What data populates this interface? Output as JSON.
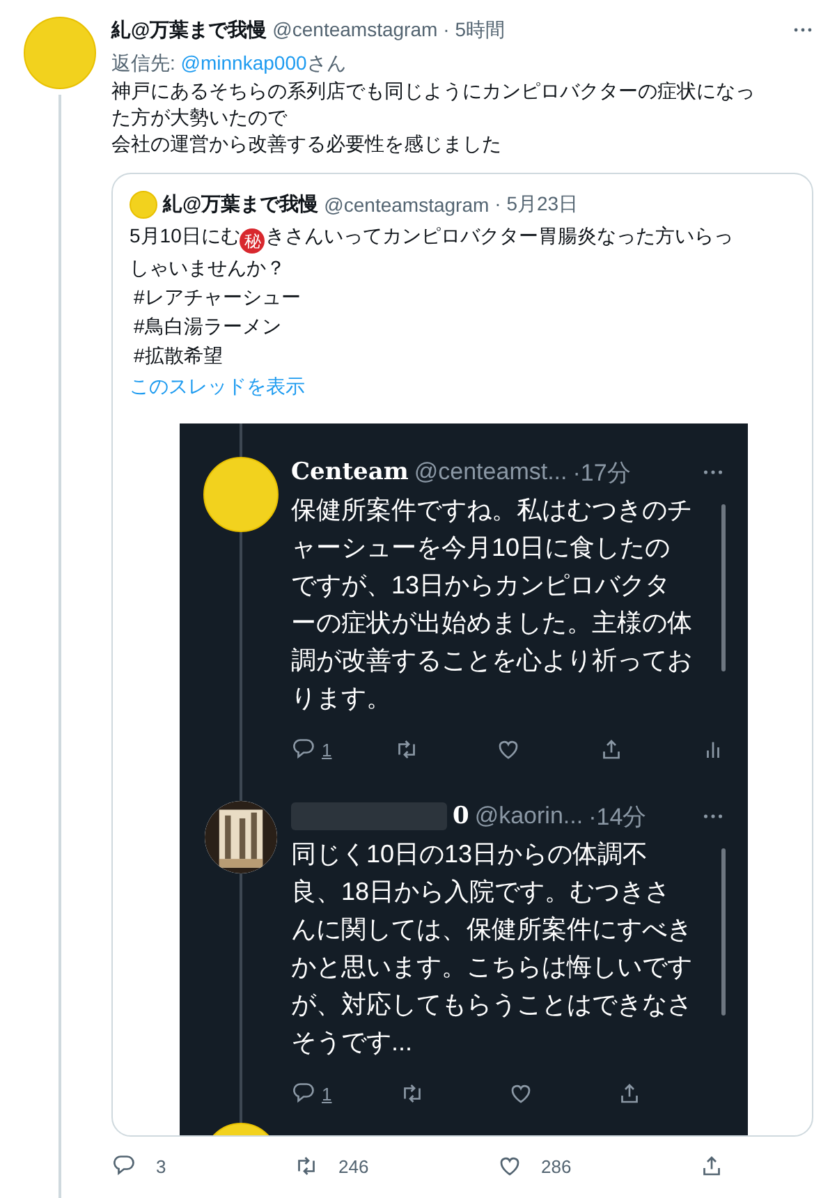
{
  "tweet": {
    "author": {
      "name": "糺@万葉まで我慢",
      "handle": "@centeamstagram",
      "time": "· 5時間"
    },
    "reply_to": {
      "label": "返信先: ",
      "mention": "@minnkap000",
      "suffix": "さん"
    },
    "text_lines": [
      "神戸にあるそちらの系列店でも同じようにカンピロバクターの症状になっ",
      "た方が大勢いたので",
      "会社の運営から改善する必要性を感じました"
    ],
    "quoted": {
      "author": {
        "name": "糺@万葉まで我慢",
        "handle": "@centeamstagram",
        "time": "· 5月23日"
      },
      "body_lines": [
        [
          {
            "kind": "text",
            "text": "5月10日にむ"
          },
          {
            "kind": "emoji",
            "text": "秘"
          },
          {
            "kind": "text",
            "text": "きさんいってカンピロバクター胃腸炎なった方いらっ"
          }
        ],
        [
          {
            "kind": "text",
            "text": "しゃいませんか？"
          }
        ]
      ],
      "hashtags": [
        "#レアチャーシュー",
        "#鳥白湯ラーメン",
        "#拡散希望"
      ],
      "thread_link": "このスレッドを表示",
      "screenshot": {
        "tweets": [
          {
            "kind": "cartoon",
            "name": "Centeam",
            "redacted": false,
            "handle": "@centeamst...",
            "time": "·17分",
            "text_lines": [
              "保健所案件ですね。私はむつきのチ",
              "ャーシューを今月10日に食したの",
              "ですが、13日からカンピロバクタ",
              "ーの症状が出始めました。主様の体",
              "調が改善することを心より祈ってお",
              "ります。"
            ],
            "replies": "1",
            "analytics": true
          },
          {
            "name": "0",
            "redacted": true,
            "handle": "@kaorin...",
            "time": "·14分",
            "text_lines": [
              "同じく10日の13日からの体調不",
              "良、18日から入院です。むつきさ",
              "んに関しては、保健所案件にすべき",
              "かと思います。こちらは悔しいです",
              "が、対応してもらうことはできなさ",
              "そうです..."
            ],
            "replies": "1",
            "analytics": false
          }
        ]
      }
    },
    "actions": {
      "replies": "3",
      "retweets": "246",
      "likes": "286"
    }
  }
}
